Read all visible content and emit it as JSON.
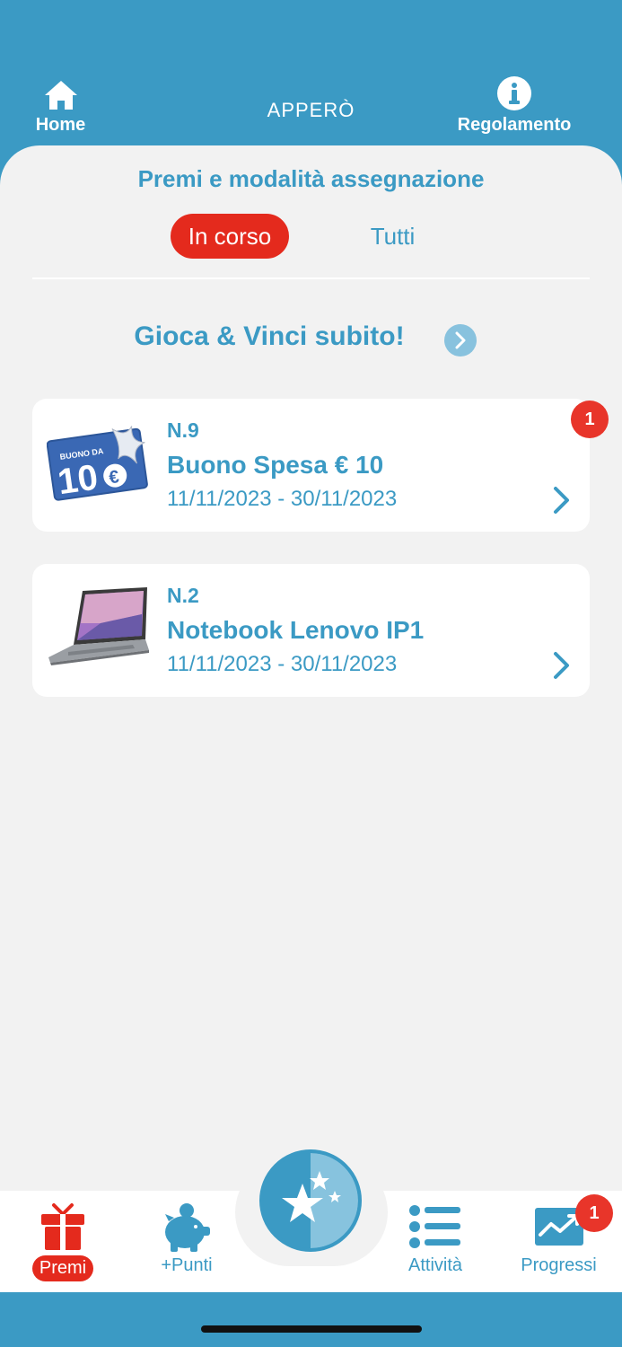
{
  "header": {
    "home_label": "Home",
    "title": "APPERÒ",
    "rules_label": "Regolamento"
  },
  "main": {
    "section_title": "Premi e modalità assegnazione",
    "filters": {
      "active": "In corso",
      "other": "Tutti"
    },
    "play_label": "Gioca & Vinci subito!",
    "prizes": [
      {
        "number": "N.9",
        "title": "Buono Spesa € 10",
        "dates": "11/11/2023 - 30/11/2023",
        "badge": "1",
        "image_text_top": "BUONO DA",
        "image_text_main": "10€"
      },
      {
        "number": "N.2",
        "title": "Notebook Lenovo IP1",
        "dates": "11/11/2023 - 30/11/2023"
      }
    ]
  },
  "bottom_nav": {
    "premi": "Premi",
    "punti": "+Punti",
    "attivita": "Attività",
    "progressi": "Progressi",
    "progressi_badge": "1"
  },
  "colors": {
    "primary": "#3b9ac4",
    "accent": "#e42a1d",
    "badge": "#e8352a",
    "background": "#f2f2f2"
  }
}
